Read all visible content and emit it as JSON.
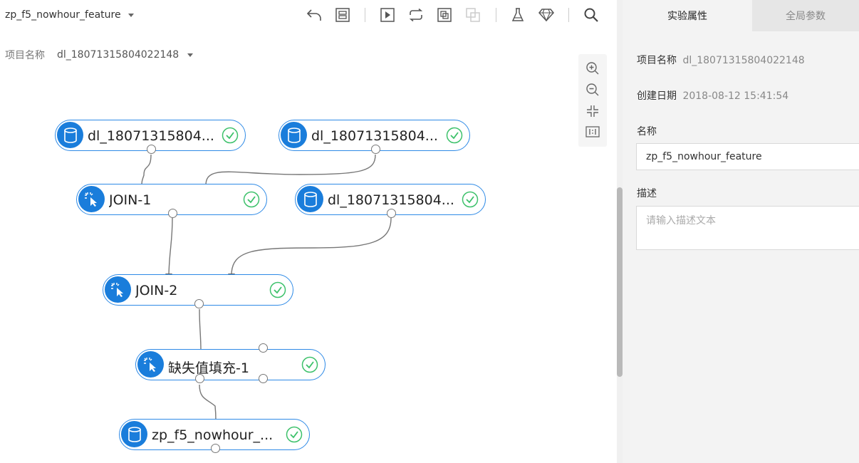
{
  "toolbar": {
    "experiment_title": "zp_f5_nowhour_feature",
    "icons": [
      "undo-icon",
      "format-layout-icon",
      "run-icon",
      "loop-icon",
      "copy-icon",
      "paste-icon",
      "experiment-flask-icon",
      "model-diamond-icon",
      "search-icon"
    ]
  },
  "project": {
    "label": "项目名称",
    "value": "dl_18071315804022148"
  },
  "nodes": {
    "data1": {
      "label": "dl_18071315804...",
      "icon": "database-icon",
      "status": "success"
    },
    "data2": {
      "label": "dl_18071315804...",
      "icon": "database-icon",
      "status": "success"
    },
    "join1": {
      "label": "JOIN-1",
      "icon": "component-icon",
      "status": "success"
    },
    "data3": {
      "label": "dl_18071315804...",
      "icon": "database-icon",
      "status": "success"
    },
    "join2": {
      "label": "JOIN-2",
      "icon": "component-icon",
      "status": "success"
    },
    "fill1": {
      "label": "缺失值填充-1",
      "icon": "component-icon",
      "status": "success"
    },
    "out1": {
      "label": "zp_f5_nowhour_...",
      "icon": "database-icon",
      "status": "success"
    }
  },
  "zoom_controls": [
    "zoom-in-icon",
    "zoom-out-icon",
    "fit-screen-icon",
    "actual-size-icon"
  ],
  "right_panel": {
    "tabs": [
      {
        "label": "实验属性",
        "active": true
      },
      {
        "label": "全局参数",
        "active": false
      }
    ],
    "project_name": {
      "label": "项目名称",
      "value": "dl_18071315804022148"
    },
    "created_date": {
      "label": "创建日期",
      "value": "2018-08-12 15:41:54"
    },
    "name": {
      "label": "名称",
      "value": "zp_f5_nowhour_feature"
    },
    "description": {
      "label": "描述",
      "placeholder": "请输入描述文本"
    }
  },
  "colors": {
    "accent": "#2e8ae6",
    "node_icon_bg": "#1a7ddb",
    "success": "#3cc16a",
    "panel_bg": "#f3f3f3"
  }
}
